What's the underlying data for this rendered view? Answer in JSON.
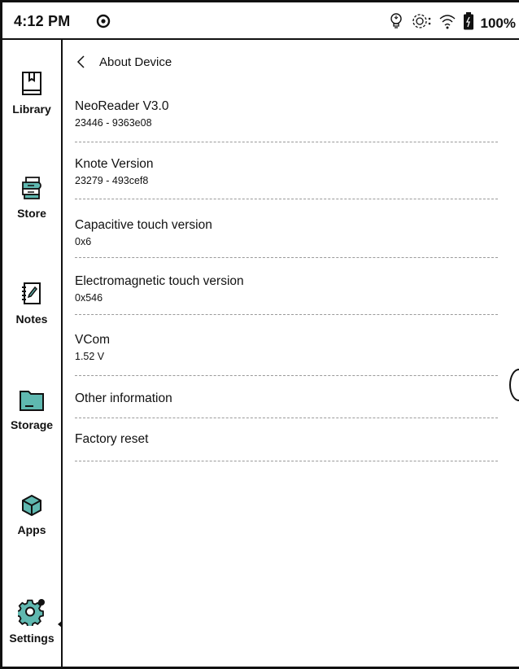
{
  "status_bar": {
    "time": "4:12 PM",
    "battery_percent": "100%",
    "icons": [
      "do-not-disturb-icon",
      "front-light-icon",
      "sync-icon",
      "wifi-icon",
      "battery-icon"
    ]
  },
  "sidebar": {
    "items": [
      {
        "label": "Library",
        "icon": "library-icon"
      },
      {
        "label": "Store",
        "icon": "store-icon"
      },
      {
        "label": "Notes",
        "icon": "notes-icon"
      },
      {
        "label": "Storage",
        "icon": "storage-icon"
      },
      {
        "label": "Apps",
        "icon": "apps-icon"
      },
      {
        "label": "Settings",
        "icon": "settings-icon",
        "selected": true
      }
    ]
  },
  "page": {
    "title": "About Device",
    "items": [
      {
        "title": "NeoReader V3.0",
        "value": "23446 - 9363e08"
      },
      {
        "title": "Knote Version",
        "value": "23279 - 493cef8"
      },
      {
        "title": "Capacitive touch version",
        "value": "0x6"
      },
      {
        "title": "Electromagnetic touch version",
        "value": "0x546"
      },
      {
        "title": "VCom",
        "value": "1.52 V"
      },
      {
        "title": "Other information"
      },
      {
        "title": "Factory reset"
      }
    ]
  }
}
